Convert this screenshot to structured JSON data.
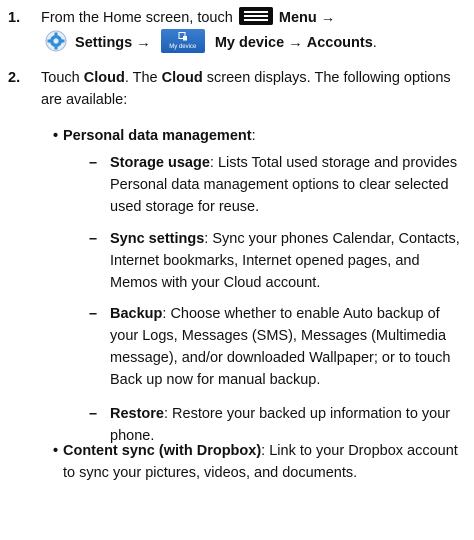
{
  "steps": [
    {
      "number": "1.",
      "parts": {
        "lead": "From the Home screen, touch",
        "menu": "Menu",
        "arrow1": "→",
        "settings": "Settings",
        "arrow2": "→",
        "mydevice_caption": "My device",
        "mydevice": "My device",
        "arrow3": "→",
        "accounts": "Accounts",
        "end": "."
      }
    },
    {
      "number": "2.",
      "parts": {
        "lead": "Touch",
        "cloud1": "Cloud",
        "mid": ". The",
        "cloud2": "Cloud",
        "rest": "screen displays. The following options are available:"
      }
    }
  ],
  "bullets": [
    {
      "marker": "•",
      "title": "Personal data management",
      "colon": ":",
      "subitems": [
        {
          "marker": "–",
          "title": "Storage usage",
          "text": ": Lists Total used storage and provides Personal data management options to clear selected used storage for reuse."
        },
        {
          "marker": "–",
          "title": "Sync settings",
          "text": ": Sync your phones Calendar, Contacts, Internet bookmarks, Internet opened pages, and Memos with your Cloud account."
        },
        {
          "marker": "–",
          "title": "Backup",
          "text": ": Choose whether to enable Auto backup of your Logs, Messages (SMS), Messages (Multimedia message), and/or downloaded Wallpaper; or to touch Back up now for manual backup."
        },
        {
          "marker": "–",
          "title": "Restore",
          "text": ": Restore your backed up information to your phone."
        }
      ]
    },
    {
      "marker": "•",
      "title": "Content sync (with Dropbox)",
      "text": ": Link to your Dropbox account to sync your pictures, videos, and documents."
    }
  ],
  "icons": {
    "menu": "menu-icon",
    "settings": "gear-icon",
    "device": "my-device-icon"
  },
  "colors": {
    "device_icon": "#2a6fc4",
    "settings_icon": "#2f8fd8",
    "menu_icon": "#0d0d0d"
  }
}
